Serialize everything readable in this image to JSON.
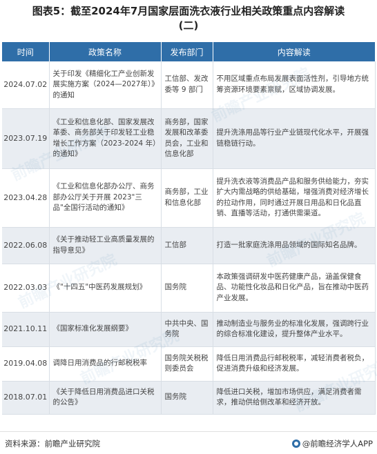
{
  "title": {
    "line1": "图表5：截至2024年7月国家层面洗衣液行业相关政策重点内容解读",
    "line2": "(二)"
  },
  "table": {
    "headers": [
      "时间",
      "政策名称",
      "发布部门",
      "内容解读"
    ],
    "rows": [
      {
        "date": "2024.07.02",
        "name": "关于印发《精细化工产业创新发展实施方案（2024—2027年）》的通知",
        "dept": "工信部、发改委等 9 部门",
        "content": "不用区域重点布局发展表面活性剂，引导地方统筹资源环境要素禀赋，区域协调发展。"
      },
      {
        "date": "2023.07.19",
        "name": "《工业和信息化部、国家发展改革委、商务部关于印发轻工业稳增长工作方案（2023-2024 年）的通知》",
        "dept": "商务部，国家发展和改革委员会，工业和信息化部",
        "content": "提升洗涤用品等行业产业链现代化水平，开展强链稳链行动。"
      },
      {
        "date": "2023.04.28",
        "name": "《工业和信息化部办公厅、商务部办公厅关于开展 2023\"三品\"全国行活动的通知》",
        "dept": "商务部，工业和信息化部",
        "content": "提升洗衣液等消费品产品和服务供给能力，夯实扩大内需战略的供给基础，增强消费对经济增长的拉动作用，同时通过开展日用品和日化品直销、直播等活动，打通供需渠道。"
      },
      {
        "date": "2022.06.08",
        "name": "《关于推动轻工业高质量发展的指导意见》",
        "dept": "工信部",
        "content": "打造一批家庭洗涤用品领域的国际知名品牌。"
      },
      {
        "date": "2022.03.03",
        "name": "《\"十四五\"中医药发展规划》",
        "dept": "国务院",
        "content": "本政策强调研发中医药健康产品，涵盖保健食品、功能性化妆品和日化产品，旨在推动中医药产业发展。"
      },
      {
        "date": "2021.10.11",
        "name": "《国家标准化发展纲要》",
        "dept": "中共中央、国务院",
        "content": "推动制造业与服务业的标准化发展，强调跨行业的综合标准化建设，提升整体产业水平。"
      },
      {
        "date": "2019.04.08",
        "name": "调降日用消费品的行邮税税率",
        "dept": "国务院关税税则委员会",
        "content": "降低日用消费品行邮税税率，减轻消费者税负，促进消费升级和经济发展。"
      },
      {
        "date": "2018.07.01",
        "name": "《关于降低日用消费品进口关税的公告》",
        "dept": "国务院",
        "content": "降低进口关税，增加市场供应，满足消费者需求，推动供给侧改革和经济开放。"
      }
    ]
  },
  "footer": {
    "source": "资料来源：前瞻产业研究院",
    "brand": "@前瞻经济学人APP"
  },
  "watermark_text": "前瞻产业研究院",
  "colors": {
    "header_bg": "#2f6ea8",
    "row_alt_bg": "#e9edf2"
  }
}
